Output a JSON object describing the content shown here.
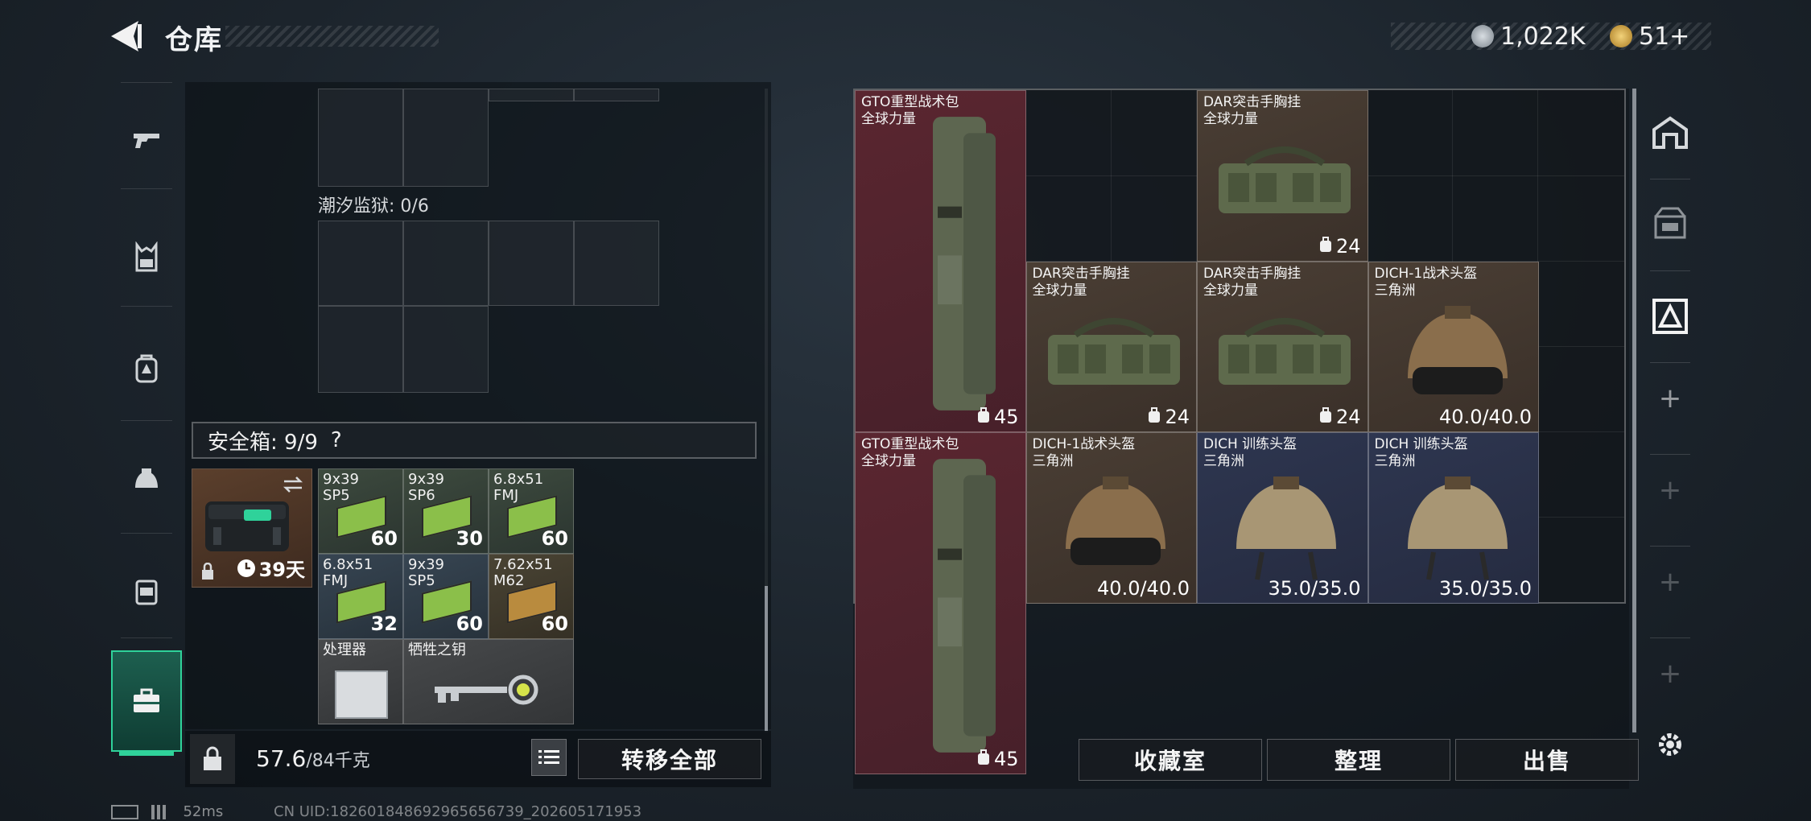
{
  "header": {
    "title": "仓库",
    "back_icon": "back-arrow-icon"
  },
  "currency": {
    "coins": "1,022K",
    "tickets": "51+",
    "coin_icon": "silver-coin-icon",
    "ticket_icon": "gold-ticket-icon"
  },
  "nav": {
    "items": [
      "gun-icon",
      "chest-rig-icon",
      "backpack-icon",
      "helmet-icon",
      "armor-icon",
      "toolbox-icon"
    ],
    "active": "toolbox-icon"
  },
  "container": {
    "label": "潮汐监狱: 0/6"
  },
  "safebox": {
    "header": "安全箱: 9/9",
    "help": "?",
    "case_timer": "39天",
    "items": [
      {
        "name": "9x39\nSP5",
        "count": "60",
        "bg": "green"
      },
      {
        "name": "9x39\nSP6",
        "count": "30",
        "bg": "green"
      },
      {
        "name": "6.8x51\nFMJ",
        "count": "60",
        "bg": "green"
      },
      {
        "name": "6.8x51\nFMJ",
        "count": "32",
        "bg": "blue"
      },
      {
        "name": "9x39\nSP5",
        "count": "60",
        "bg": "blue"
      },
      {
        "name": "7.62x51\nM62",
        "count": "60",
        "bg": "tan"
      },
      {
        "name": "处理器",
        "count": "",
        "bg": "gray"
      },
      {
        "name": "牺牲之钥",
        "count": "",
        "bg": "gray"
      }
    ]
  },
  "bottom": {
    "weight_value": "57.6",
    "weight_max": "/84千克",
    "transfer_all": "转移全部"
  },
  "stash": {
    "items": [
      {
        "name": "GTO重型战术包\n全球力量",
        "count": "45",
        "kind": "backpack"
      },
      {
        "name": "DAR突击手胸挂\n全球力量",
        "count": "24",
        "kind": "rig"
      },
      {
        "name": "GTO重型战术包\n全球力量",
        "count": "45",
        "kind": "backpack"
      },
      {
        "name": "DAR突击手胸挂\n全球力量",
        "count": "24",
        "kind": "rig"
      },
      {
        "name": "DAR突击手胸挂\n全球力量",
        "count": "24",
        "kind": "rig"
      },
      {
        "name": "DICH-1战术头盔\n三角洲",
        "count": "40.0/40.0",
        "kind": "helmet-tan"
      },
      {
        "name": "DICH-1战术头盔\n三角洲",
        "count": "40.0/40.0",
        "kind": "helmet-tan"
      },
      {
        "name": "DICH 训练头盔\n三角洲",
        "count": "35.0/35.0",
        "kind": "helmet-camo"
      },
      {
        "name": "DICH 训练头盔\n三角洲",
        "count": "35.0/35.0",
        "kind": "helmet-camo"
      }
    ]
  },
  "actions": {
    "collection": "收藏室",
    "sort": "整理",
    "sell": "出售"
  },
  "side": {
    "items": [
      "depot-icon",
      "storage-icon",
      "tagged-icon"
    ],
    "add": "+"
  },
  "status": {
    "ping": "52ms",
    "uid": "CN UID:182601848692965656739_202605171953"
  },
  "colors": {
    "accent": "#2fd29a",
    "red_item": "#5a2630",
    "brown_item": "#4a3e34",
    "navy_item": "#2e3650"
  }
}
